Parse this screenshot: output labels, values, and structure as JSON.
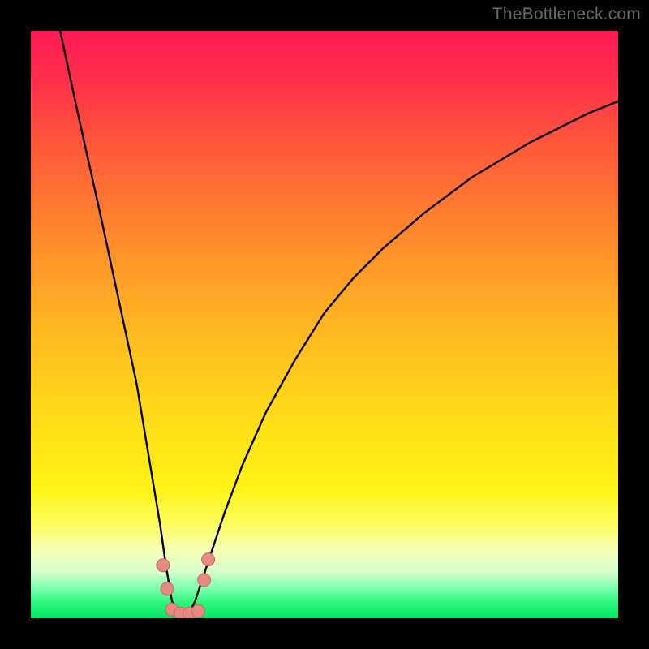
{
  "watermark": "TheBottleneck.com",
  "colors": {
    "frame": "#000000",
    "gradient_top": "#ff1a55",
    "gradient_mid": "#ffe018",
    "gradient_bottom": "#00e765",
    "curve_stroke": "#000000",
    "marker_fill": "#e68a84",
    "marker_stroke": "#c9645c"
  },
  "chart_data": {
    "type": "line",
    "title": "",
    "xlabel": "",
    "ylabel": "",
    "xlim": [
      0,
      100
    ],
    "ylim": [
      0,
      100
    ],
    "note": "V-shaped bottleneck curve; y≈100 is red (bad), y≈0 is green (no bottleneck). Minimum near x≈25.",
    "series": [
      {
        "name": "bottleneck-curve",
        "x": [
          5,
          8,
          12,
          15,
          18,
          20,
          22,
          23,
          24,
          25,
          26,
          27,
          28,
          30,
          33,
          36,
          40,
          45,
          50,
          55,
          60,
          67,
          75,
          85,
          95,
          100
        ],
        "y": [
          100,
          86,
          68,
          54,
          40,
          28,
          16,
          9,
          3,
          0.5,
          0.5,
          0.8,
          3,
          9,
          18,
          26,
          35,
          44,
          52,
          58,
          63,
          69,
          75,
          81,
          86,
          88
        ]
      }
    ],
    "markers": [
      {
        "name": "left-cluster-upper",
        "x": 22.5,
        "y": 9,
        "r": 1.1
      },
      {
        "name": "left-cluster-lower",
        "x": 23.2,
        "y": 5,
        "r": 1.1
      },
      {
        "name": "bottom-left",
        "x": 24.0,
        "y": 1.5,
        "r": 1.1
      },
      {
        "name": "bottom-mid-1",
        "x": 25.5,
        "y": 0.8,
        "r": 1.1
      },
      {
        "name": "bottom-mid-2",
        "x": 27.0,
        "y": 0.8,
        "r": 1.1
      },
      {
        "name": "bottom-right",
        "x": 28.5,
        "y": 1.2,
        "r": 1.1
      },
      {
        "name": "right-cluster-lower",
        "x": 29.5,
        "y": 6.5,
        "r": 1.1
      },
      {
        "name": "right-cluster-upper",
        "x": 30.2,
        "y": 10,
        "r": 1.1
      }
    ]
  }
}
